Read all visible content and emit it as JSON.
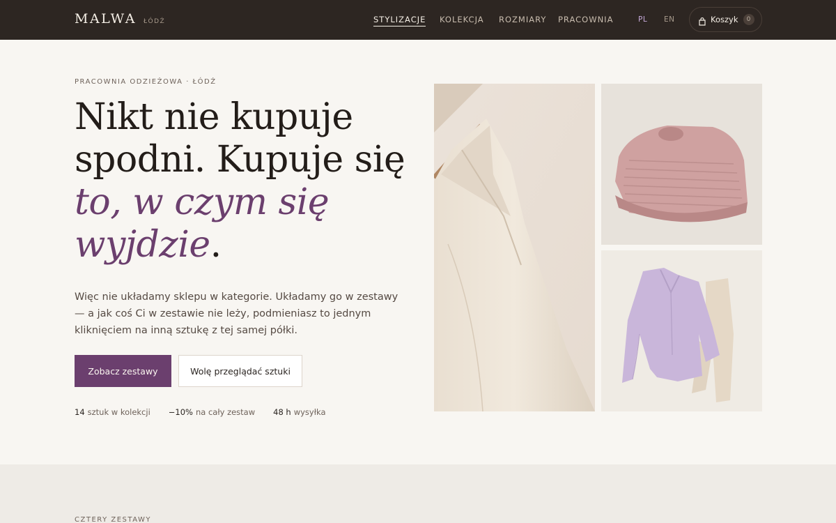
{
  "header": {
    "brand": "MALWA",
    "city": "ŁÓDŹ",
    "nav": [
      {
        "label": "STYLIZACJE",
        "active": true
      },
      {
        "label": "KOLEKCJA",
        "active": false
      },
      {
        "label": "ROZMIARY",
        "active": false
      },
      {
        "label": "PRACOWNIA",
        "active": false
      }
    ],
    "languages": [
      {
        "label": "PL",
        "active": true
      },
      {
        "label": "EN",
        "active": false
      }
    ],
    "cart": {
      "label": "Koszyk",
      "count": "0",
      "icon": "shopping-bag-icon"
    }
  },
  "hero": {
    "eyebrow": "PRACOWNIA ODZIEŻOWA · ŁÓDŹ",
    "headline_plain": "Nikt nie kupuje spodni. Kupuje się ",
    "headline_accent": "to, w czym się wyjdzie",
    "headline_end": ".",
    "lead": "Więc nie układamy sklepu w kategorie. Układamy go w zestawy — a jak coś Ci w zestawie nie leży, podmieniasz to jednym kliknięciem na inną sztukę z tej samej półki.",
    "cta_primary": "Zobacz zestawy",
    "cta_secondary": "Wolę przeglądać sztuki",
    "stats": [
      {
        "value": "14",
        "label": "sztuk w kolekcji"
      },
      {
        "value": "−10%",
        "label": "na cały zestaw"
      },
      {
        "value": "48 h",
        "label": "wysyłka"
      }
    ]
  },
  "next_section": {
    "eyebrow": "CZTERY ZESTAWY"
  },
  "colors": {
    "header_bg": "#2d2622",
    "accent": "#6b3f6e",
    "page_bg": "#f8f6f2",
    "section_bg": "#eeebe6"
  }
}
